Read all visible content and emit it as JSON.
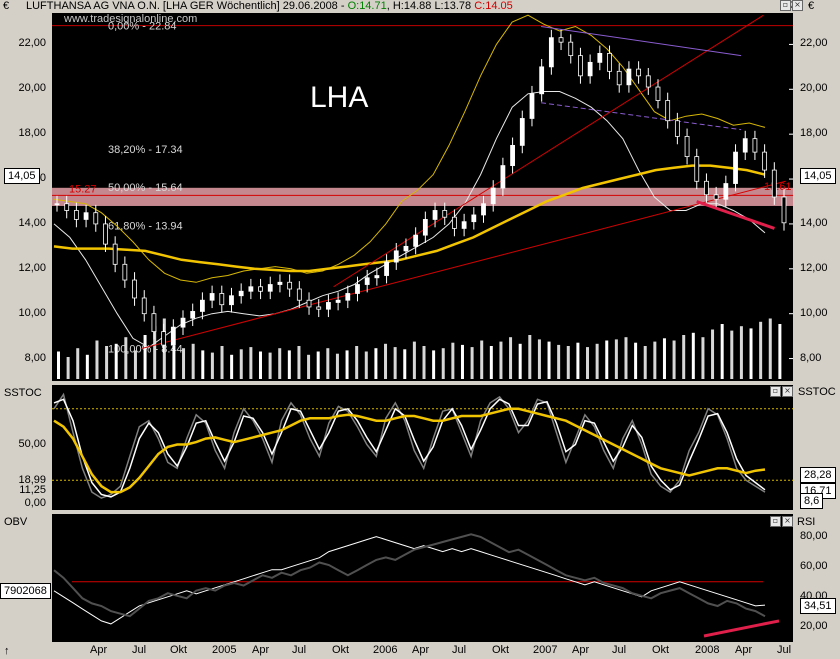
{
  "header": {
    "currency": "€",
    "prefix": "LUFTHANSA AG VNA O.N. [LHA GER  Wöchentlich] 29.06.2008 - ",
    "open": "O:14.71",
    "high": "H:14.88",
    "low": "L:13.78",
    "close": "C:14.05",
    "website": "www.tradesignalonline.com",
    "corner_right": "2€"
  },
  "chart_data": [
    {
      "type": "candlestick",
      "title": "LHA",
      "panel": "price",
      "y_axis_unit": "€",
      "y_ticks": [
        8,
        10,
        12,
        14,
        16,
        18,
        20,
        22
      ],
      "y_tick_labels": [
        "8,00",
        "10,00",
        "12,00",
        "14,00",
        "16,00",
        "18,00",
        "20,00",
        "22,00"
      ],
      "ylim": [
        7.0,
        23.4
      ],
      "x_tick_labels": [
        "Apr",
        "Jul",
        "Okt",
        "2005",
        "Apr",
        "Jul",
        "Okt",
        "2006",
        "Apr",
        "Jul",
        "Okt",
        "2007",
        "Apr",
        "Jul",
        "Okt",
        "2008",
        "Apr",
        "Jul"
      ],
      "last_price_label": "14,05",
      "fib_levels": [
        {
          "label": "0,00% - 22.84",
          "value": 22.84
        },
        {
          "label": "38,20% - 17.34",
          "value": 17.34
        },
        {
          "label": "50,00% - 15.64",
          "value": 15.64
        },
        {
          "label": "61,80% - 13.94",
          "value": 13.94
        },
        {
          "label": "100,00% - 8.44",
          "value": 8.44
        }
      ],
      "annotations": [
        {
          "text": "15.27",
          "value": 15.27,
          "color": "#d40000"
        },
        {
          "text": "15.61",
          "value": 15.61,
          "color": "#d40000"
        }
      ],
      "close_series": [
        14.9,
        14.6,
        14.2,
        14.5,
        14.0,
        13.1,
        12.2,
        11.5,
        10.7,
        10.0,
        9.2,
        8.6,
        9.4,
        9.8,
        10.1,
        10.6,
        10.9,
        10.4,
        10.8,
        11.0,
        11.2,
        11.0,
        11.3,
        11.4,
        11.1,
        10.6,
        10.3,
        10.2,
        10.5,
        10.6,
        10.9,
        11.3,
        11.6,
        11.7,
        12.3,
        12.8,
        13.0,
        13.5,
        14.2,
        14.6,
        14.3,
        13.8,
        14.1,
        14.4,
        14.9,
        15.6,
        16.6,
        17.5,
        18.7,
        19.8,
        21.0,
        22.3,
        22.1,
        21.5,
        20.6,
        21.2,
        21.6,
        20.8,
        20.2,
        20.9,
        20.6,
        20.1,
        19.5,
        18.6,
        17.9,
        17.0,
        15.9,
        15.3,
        15.1,
        15.8,
        17.2,
        17.8,
        17.2,
        16.4,
        15.2,
        14.05
      ],
      "volume_series": [
        25,
        20,
        28,
        22,
        35,
        30,
        32,
        38,
        26,
        40,
        48,
        55,
        30,
        28,
        32,
        26,
        24,
        30,
        22,
        27,
        29,
        25,
        24,
        28,
        26,
        30,
        22,
        25,
        28,
        23,
        26,
        30,
        25,
        28,
        32,
        29,
        27,
        34,
        30,
        26,
        28,
        33,
        31,
        29,
        35,
        30,
        34,
        38,
        32,
        40,
        36,
        34,
        31,
        30,
        33,
        29,
        32,
        35,
        36,
        38,
        33,
        30,
        34,
        37,
        35,
        40,
        42,
        38,
        45,
        50,
        44,
        48,
        46,
        52,
        55,
        50
      ],
      "ma_series": [
        13.0,
        12.9,
        12.9,
        12.9,
        12.85,
        12.8,
        12.6,
        12.4,
        12.3,
        12.2,
        12.1,
        12.0,
        11.95,
        11.9,
        11.9,
        12.0,
        12.1,
        12.2,
        12.3,
        12.4,
        12.6,
        12.8,
        13.1,
        13.4,
        13.8,
        14.2,
        14.6,
        15.0,
        15.3,
        15.6,
        15.8,
        16.0,
        16.2,
        16.4,
        16.5,
        16.6,
        16.6,
        16.5,
        16.4,
        16.2
      ],
      "upper_band": [
        15.1,
        15.0,
        14.9,
        14.5,
        13.9,
        13.2,
        12.4,
        11.8,
        11.5,
        11.4,
        11.6,
        11.7,
        11.9,
        12.0,
        12.1,
        12.0,
        11.8,
        11.9,
        12.2,
        12.6,
        13.2,
        14.0,
        15.0,
        15.5,
        16.2,
        17.5,
        19.0,
        20.6,
        22.0,
        23.0,
        23.3,
        22.9,
        22.6,
        22.8,
        22.4,
        21.8,
        21.0,
        20.0,
        19.0,
        18.6,
        18.8,
        18.9,
        18.7,
        18.4,
        18.5,
        18.3
      ],
      "lower_band": [
        14.0,
        13.4,
        12.4,
        11.2,
        10.0,
        8.9,
        8.5,
        9.0,
        9.5,
        9.8,
        10.0,
        10.1,
        10.0,
        9.9,
        10.0,
        10.2,
        10.5,
        10.8,
        11.0,
        11.3,
        11.8,
        12.2,
        12.6,
        13.0,
        13.4,
        14.0,
        14.9,
        16.2,
        17.8,
        19.2,
        19.8,
        19.9,
        19.9,
        19.6,
        19.2,
        18.6,
        17.8,
        16.4,
        15.2,
        14.6,
        14.6,
        14.9,
        14.9,
        14.6,
        14.2,
        13.6
      ],
      "trendlines": [
        {
          "role": "support",
          "from": [
            0.12,
            8.44
          ],
          "to": [
            0.99,
            15.9
          ],
          "color": "#d40000"
        },
        {
          "role": "steep",
          "from": [
            0.38,
            11.2
          ],
          "to": [
            0.96,
            23.3
          ],
          "color": "#d40000"
        },
        {
          "role": "channel-top",
          "from": [
            0.66,
            22.8
          ],
          "to": [
            0.93,
            21.5
          ],
          "color": "#8a5cd0"
        },
        {
          "role": "channel-mid",
          "from": [
            0.66,
            19.4
          ],
          "to": [
            0.93,
            18.2
          ],
          "color": "#8a5cd0"
        },
        {
          "role": "recent-lows",
          "from": [
            0.87,
            15.0
          ],
          "to": [
            0.975,
            13.8
          ],
          "color": "#e0204a"
        }
      ]
    },
    {
      "type": "line",
      "panel": "oscillator",
      "title": "SSTOC",
      "ylim": [
        -5,
        100
      ],
      "y_tick_labels": [
        "50,00",
        "18,99",
        "11,25",
        "0,00"
      ],
      "y_ticks": [
        50,
        18.99,
        11.25,
        0
      ],
      "right_labels": [
        "SSTOC",
        "28,28",
        "16,71",
        "8,6"
      ],
      "right_values": [
        28.28,
        16.71,
        8.6
      ],
      "series": [
        {
          "color": "#808080",
          "values": [
            80,
            92,
            60,
            30,
            10,
            5,
            8,
            15,
            40,
            65,
            70,
            55,
            35,
            30,
            55,
            75,
            68,
            45,
            30,
            60,
            80,
            70,
            55,
            35,
            70,
            85,
            75,
            55,
            40,
            68,
            82,
            78,
            65,
            50,
            40,
            72,
            85,
            70,
            45,
            30,
            55,
            78,
            80,
            60,
            40,
            70,
            85,
            90,
            80,
            60,
            70,
            88,
            85,
            60,
            35,
            55,
            75,
            65,
            45,
            30,
            55,
            70,
            50,
            25,
            15,
            10,
            20,
            45,
            60,
            80,
            75,
            55,
            30,
            20,
            15,
            10
          ]
        },
        {
          "color": "#ffffff",
          "values": [
            85,
            88,
            70,
            40,
            18,
            8,
            6,
            10,
            30,
            55,
            68,
            60,
            42,
            32,
            48,
            68,
            70,
            52,
            36,
            52,
            74,
            72,
            60,
            42,
            60,
            80,
            78,
            62,
            46,
            60,
            78,
            80,
            70,
            56,
            44,
            62,
            80,
            74,
            54,
            36,
            48,
            70,
            80,
            66,
            46,
            62,
            80,
            88,
            84,
            66,
            66,
            84,
            86,
            68,
            44,
            50,
            70,
            68,
            52,
            36,
            48,
            66,
            56,
            32,
            20,
            12,
            16,
            36,
            54,
            74,
            76,
            60,
            38,
            24,
            18,
            12
          ]
        },
        {
          "color": "#f0c400",
          "values": [
            70,
            65,
            55,
            40,
            25,
            15,
            10,
            10,
            14,
            22,
            32,
            42,
            48,
            50,
            50,
            52,
            55,
            56,
            54,
            52,
            54,
            56,
            58,
            60,
            62,
            66,
            70,
            72,
            72,
            72,
            74,
            75,
            74,
            72,
            70,
            70,
            72,
            74,
            74,
            72,
            70,
            70,
            72,
            74,
            74,
            74,
            76,
            78,
            80,
            80,
            78,
            76,
            74,
            72,
            70,
            66,
            62,
            58,
            54,
            50,
            46,
            42,
            38,
            34,
            30,
            28,
            26,
            24,
            26,
            28,
            30,
            30,
            28,
            26,
            28,
            29
          ]
        }
      ]
    },
    {
      "type": "line",
      "panel": "obv_rsi",
      "title_left": "OBV",
      "title_right": "RSI",
      "obv_value_label": "7902068",
      "rsi_ylim": [
        10,
        95
      ],
      "rsi_ticks": [
        20,
        40,
        60,
        80
      ],
      "rsi_tick_labels": [
        "20,00",
        "40,00",
        "60,00",
        "80,00"
      ],
      "rsi_last_label": "34,51",
      "series": [
        {
          "name": "OBV",
          "color": "#505050",
          "values": [
            62,
            56,
            48,
            40,
            36,
            34,
            30,
            28,
            26,
            32,
            38,
            40,
            44,
            42,
            40,
            46,
            48,
            46,
            50,
            52,
            50,
            54,
            58,
            56,
            60,
            58,
            62,
            64,
            68,
            66,
            62,
            58,
            62,
            66,
            70,
            72,
            70,
            74,
            78,
            80,
            82,
            84,
            86,
            88,
            90,
            88,
            84,
            80,
            76,
            78,
            74,
            70,
            66,
            62,
            58,
            56,
            54,
            56,
            52,
            50,
            48,
            44,
            42,
            40,
            44,
            46,
            48,
            44,
            40,
            36,
            34,
            38,
            36,
            32,
            30,
            26
          ]
        },
        {
          "name": "RSI",
          "color": "#ffffff",
          "values": [
            44,
            40,
            36,
            32,
            28,
            24,
            22,
            26,
            30,
            34,
            36,
            38,
            40,
            42,
            44,
            42,
            44,
            46,
            48,
            50,
            52,
            54,
            56,
            58,
            58,
            60,
            62,
            64,
            66,
            70,
            72,
            74,
            76,
            78,
            80,
            78,
            76,
            74,
            72,
            74,
            72,
            70,
            72,
            70,
            72,
            70,
            68,
            66,
            64,
            62,
            60,
            58,
            56,
            54,
            52,
            50,
            48,
            50,
            48,
            46,
            44,
            42,
            40,
            44,
            46,
            48,
            50,
            48,
            46,
            44,
            42,
            40,
            38,
            36,
            34,
            34.51
          ]
        }
      ]
    }
  ],
  "x_axis_labels": [
    "Apr",
    "Jul",
    "Okt",
    "2005",
    "Apr",
    "Jul",
    "Okt",
    "2006",
    "Apr",
    "Jul",
    "Okt",
    "2007",
    "Apr",
    "Jul",
    "Okt",
    "2008",
    "Apr",
    "Jul"
  ]
}
